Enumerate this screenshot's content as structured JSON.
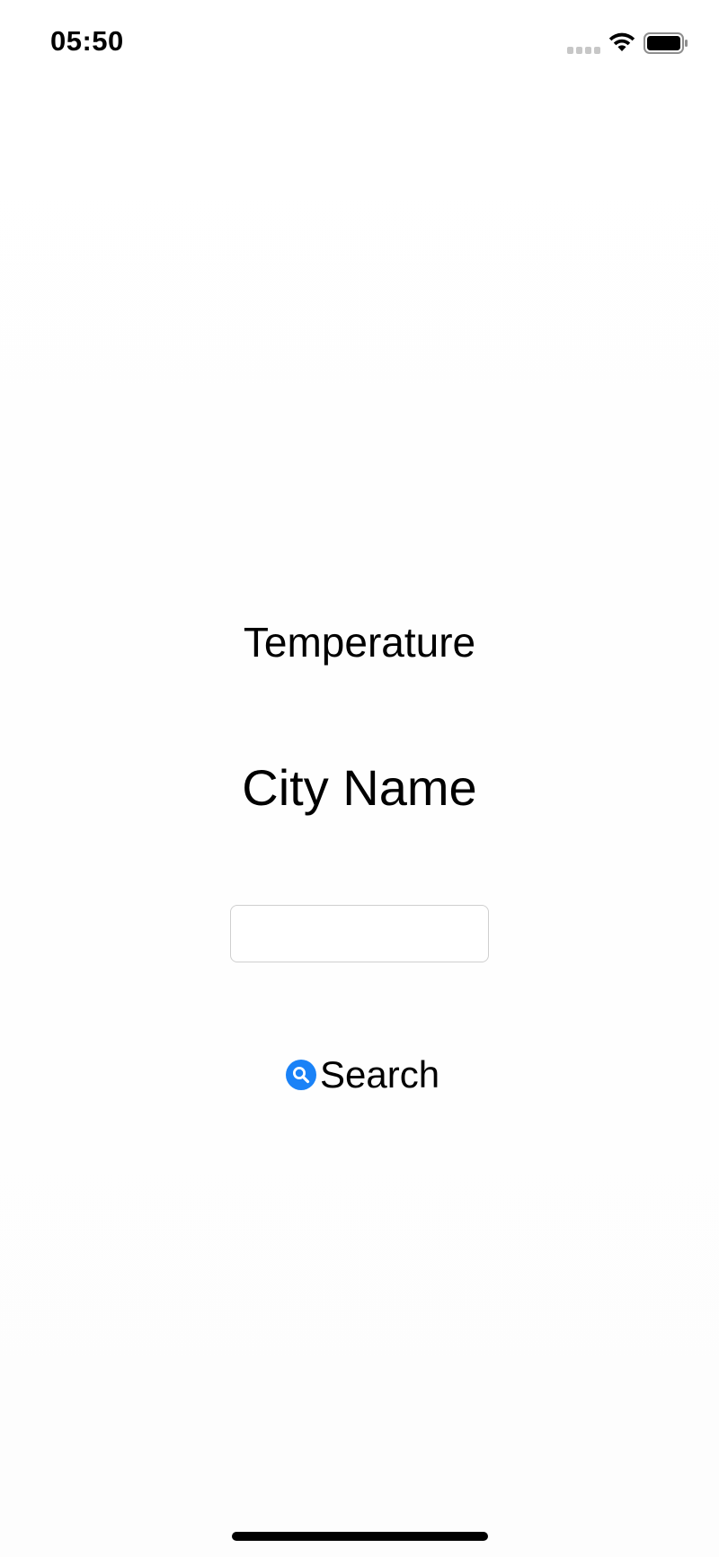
{
  "status_bar": {
    "time": "05:50",
    "icons": [
      "signal-icon",
      "wifi-icon",
      "battery-icon"
    ]
  },
  "main": {
    "temperature_label": "Temperature",
    "city_label": "City Name",
    "city_input": {
      "value": "",
      "placeholder": ""
    },
    "search_button": {
      "label": "Search",
      "icon": "magnifying-glass-icon"
    }
  },
  "colors": {
    "accent": "#1a82f7",
    "text": "#000000",
    "input_border": "#cfcfcf",
    "background": "#fdfdfd"
  }
}
